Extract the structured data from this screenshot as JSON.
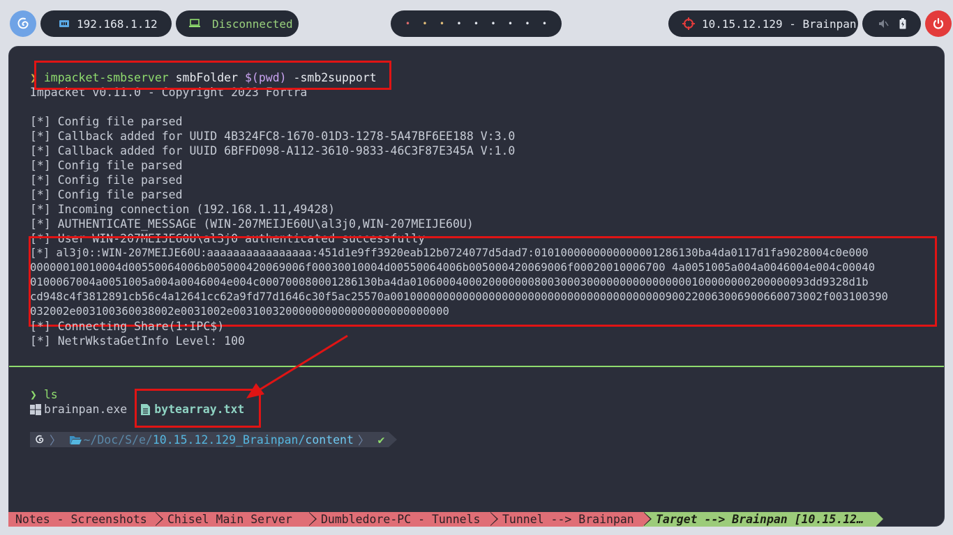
{
  "topbar": {
    "ip_label": "192.168.1.12",
    "vpn_status": "Disconnected",
    "workspace_dots": [
      "•",
      "•",
      "•",
      "•",
      "•",
      "•",
      "•",
      "•",
      "•"
    ],
    "workspace_colors": [
      "#e06c6c",
      "#e5c07b",
      "#e5c07b",
      "#e5e9f0",
      "#e5e9f0",
      "#e5e9f0",
      "#e5e9f0",
      "#e5e9f0",
      "#e5e9f0"
    ],
    "target_label": "10.15.12.129 - Brainpan",
    "accent_color": "#e33b3b"
  },
  "terminal": {
    "prompt_symbol": "❯",
    "command": {
      "bin": "impacket-smbserver",
      "args_a": " smbFolder ",
      "args_b": "$(pwd)",
      "args_c": " -smb2support"
    },
    "output_header": "Impacket v0.11.0 - Copyright 2023 Fortra",
    "output": [
      "[*] Config file parsed",
      "[*] Callback added for UUID 4B324FC8-1670-01D3-1278-5A47BF6EE188 V:3.0",
      "[*] Callback added for UUID 6BFFD098-A112-3610-9833-46C3F87E345A V:1.0",
      "[*] Config file parsed",
      "[*] Config file parsed",
      "[*] Config file parsed",
      "[*] Incoming connection (192.168.1.11,49428)",
      "[*] AUTHENTICATE_MESSAGE (WIN-207MEIJE60U\\al3j0,WIN-207MEIJE60U)",
      "[*] User WIN-207MEIJE60U\\al3j0 authenticated successfully"
    ],
    "hash_lines": [
      "[*] al3j0::WIN-207MEIJE60U:aaaaaaaaaaaaaaaa:451d1e9ff3920eab12b0724077d5dad7:0101000000000000001286130ba4da0117d1fa9028004c0e000",
      "00000010010004d00550064006b005000420069006f00030010004d00550064006b005000420069006f00020010006700 4a0051005a004a0046004e004c00040",
      "0100067004a0051005a004a0046004e004c000700080001286130ba4da0106000400020000000800300030000000000000000100000000200000093dd9328d1b",
      "cd948c4f3812891cb56c4a12641cc62a9fd77d1646c30f5ac25570a001000000000000000000000000000000000000000900220063006900660073002f003100390",
      "032002e003100360038002e0031002e003100320000000000000000000000000"
    ],
    "output_after": [
      "[*] Connecting Share(1:IPC$)",
      "[*] NetrWkstaGetInfo Level: 100"
    ],
    "ls_command": "ls",
    "files": [
      {
        "name": "brainpan.exe",
        "icon": "windows-icon"
      },
      {
        "name": "bytearray.txt",
        "icon": "file-icon"
      }
    ],
    "prompt_path": {
      "home": "~/Doc/S/e/",
      "dir": "10.15.12.129_Brainpan/",
      "leaf": "content",
      "status": "✔"
    }
  },
  "tabs": [
    "Notes - Screenshots",
    "Chisel Main Server",
    "Dumbledore-PC - Tunnels",
    "Tunnel --> Brainpan",
    "Target --> Brainpan [10.15.12…"
  ]
}
